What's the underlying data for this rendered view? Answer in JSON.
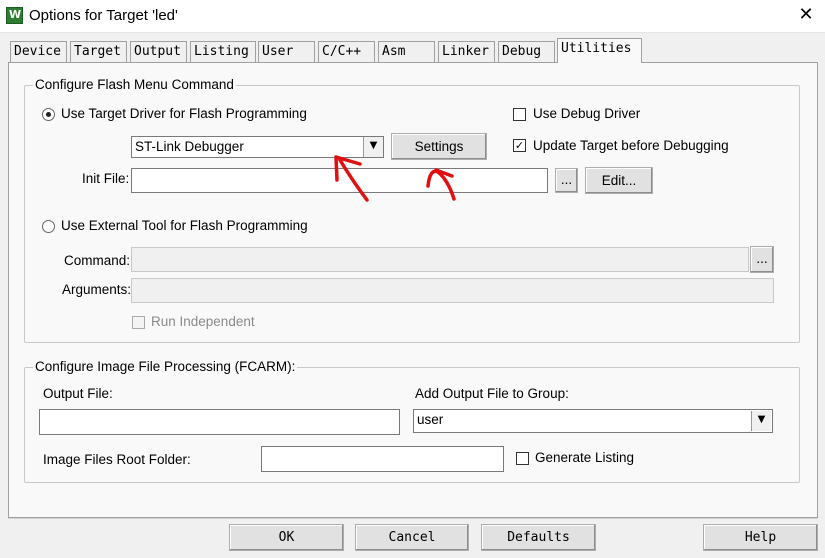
{
  "window": {
    "title": "Options for Target 'led'",
    "icon_letter": "W",
    "close_glyph": "✕"
  },
  "tabs": [
    "Device",
    "Target",
    "Output",
    "Listing",
    "User",
    "C/C++",
    "Asm",
    "Linker",
    "Debug",
    "Utilities"
  ],
  "active_tab": "Utilities",
  "flash_group": {
    "legend": "Configure Flash Menu Command",
    "use_target_driver_label": "Use Target Driver for Flash Programming",
    "use_target_driver_selected": true,
    "driver_value": "ST-Link Debugger",
    "settings_label": "Settings",
    "use_debug_driver_label": "Use Debug Driver",
    "use_debug_driver_checked": false,
    "update_target_label": "Update Target before Debugging",
    "update_target_checked": true,
    "init_file_label": "Init File:",
    "init_file_value": "",
    "browse_label": "...",
    "edit_label": "Edit...",
    "use_external_tool_label": "Use External Tool for Flash Programming",
    "use_external_tool_selected": false,
    "command_label": "Command:",
    "command_value": "",
    "command_browse_label": "...",
    "arguments_label": "Arguments:",
    "arguments_value": "",
    "run_independent_label": "Run Independent",
    "run_independent_checked": false
  },
  "image_group": {
    "legend": "Configure Image File Processing (FCARM):",
    "output_file_label": "Output File:",
    "output_file_value": "",
    "add_output_label": "Add Output File  to Group:",
    "group_value": "user",
    "root_folder_label": "Image Files Root Folder:",
    "root_folder_value": "",
    "generate_listing_label": "Generate Listing",
    "generate_listing_checked": false
  },
  "buttons": {
    "ok": "OK",
    "cancel": "Cancel",
    "defaults": "Defaults",
    "help": "Help"
  },
  "annotations": {
    "arrow_color": "#e01010"
  },
  "icons": {
    "check_glyph": "✓",
    "dropdown_glyph": "▼"
  }
}
